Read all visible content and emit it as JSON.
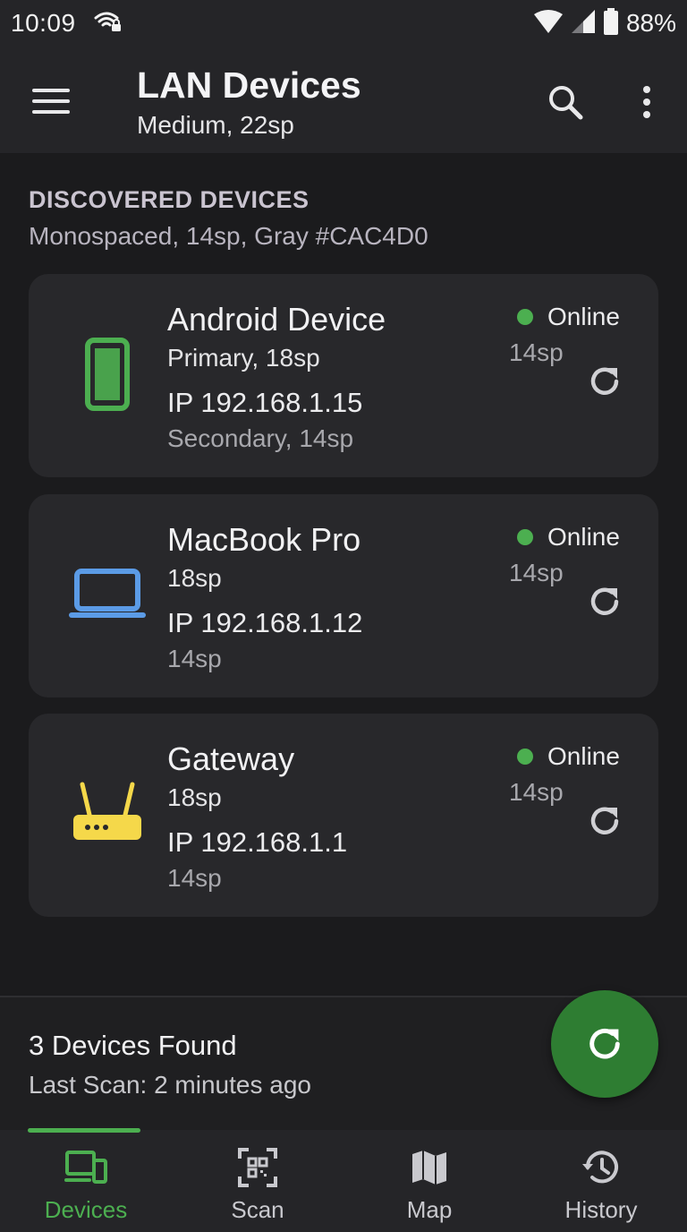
{
  "status_bar": {
    "time": "10:09",
    "battery": "88%",
    "icons": [
      "wifi-lock-icon",
      "wifi-signal-icon",
      "cell-signal-icon",
      "battery-icon"
    ]
  },
  "app_bar": {
    "title": "LAN Devices",
    "subtitle": "Medium, 22sp",
    "icons": [
      "menu-icon",
      "search-icon",
      "more-vert-icon"
    ]
  },
  "section": {
    "title": "DISCOVERED DEVICES",
    "subtitle": "Monospaced, 14sp, Gray #CAC4D0"
  },
  "devices": [
    {
      "name": "Android Device",
      "name_note": "Primary, 18sp",
      "ip": "IP 192.168.1.15",
      "ip_note": "Secondary, 14sp",
      "status": "Online",
      "status_note": "14sp",
      "icon": "phone-icon",
      "icon_color": "#4caf50"
    },
    {
      "name": "MacBook Pro",
      "name_note": "18sp",
      "ip": "IP 192.168.1.12",
      "ip_note": "14sp",
      "status": "Online",
      "status_note": "14sp",
      "icon": "laptop-icon",
      "icon_color": "#5b9be6"
    },
    {
      "name": "Gateway",
      "name_note": "18sp",
      "ip": "IP 192.168.1.1",
      "ip_note": "14sp",
      "status": "Online",
      "status_note": "14sp",
      "icon": "router-icon",
      "icon_color": "#f5d84a"
    }
  ],
  "summary": {
    "title": "3 Devices Found",
    "subtitle": "Last Scan: 2 minutes ago"
  },
  "fab": {
    "icon": "refresh-icon",
    "color": "#2e7d32"
  },
  "nav": {
    "items": [
      {
        "label": "Devices",
        "icon": "devices-icon",
        "active": true
      },
      {
        "label": "Scan",
        "icon": "qr-scan-icon",
        "active": false
      },
      {
        "label": "Map",
        "icon": "map-icon",
        "active": false
      },
      {
        "label": "History",
        "icon": "history-icon",
        "active": false
      }
    ]
  },
  "colors": {
    "accent": "#4caf50",
    "online": "#4caf50",
    "section_gray": "#CAC4D0"
  }
}
